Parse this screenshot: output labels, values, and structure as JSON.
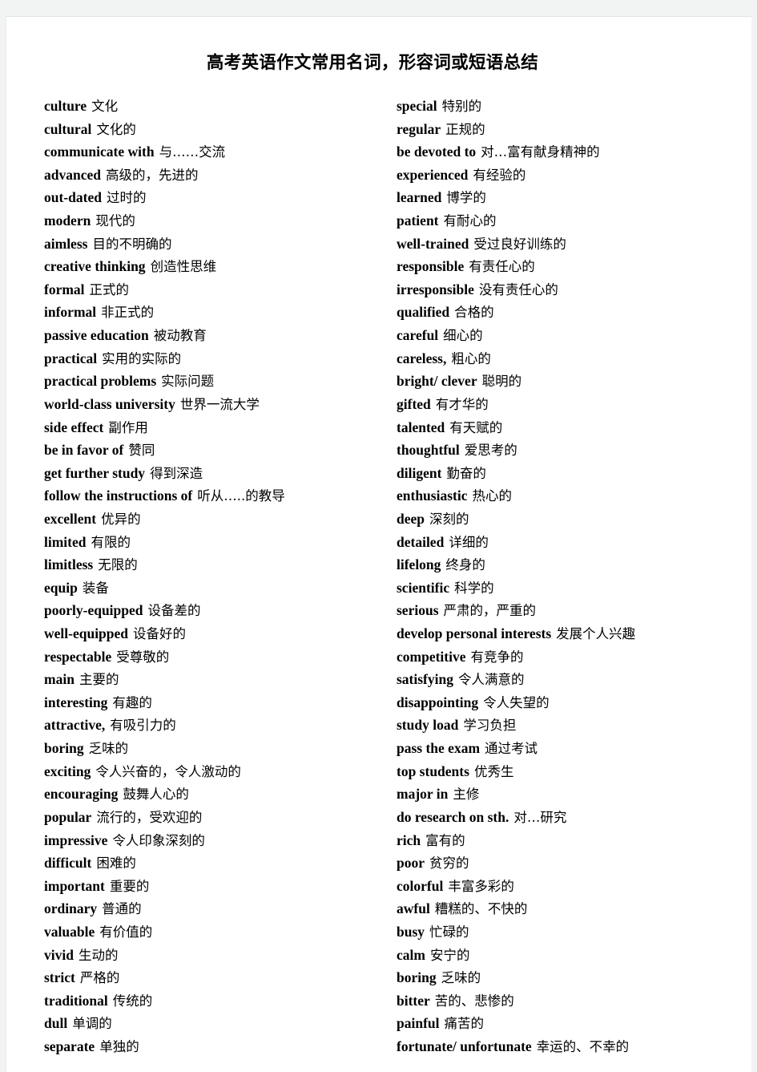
{
  "document": {
    "title": "高考英语作文常用名词，形容词或短语总结",
    "page_background": "#ffffff",
    "surround_background": "#f2f3f3",
    "text_color": "#000000"
  },
  "columns": {
    "left": [
      {
        "term": "culture",
        "gloss": "文化"
      },
      {
        "term": "cultural",
        "gloss": "文化的"
      },
      {
        "term": "communicate with",
        "gloss": "与……交流"
      },
      {
        "term": "advanced",
        "gloss": "高级的，先进的"
      },
      {
        "term": "out-dated",
        "gloss": "过时的"
      },
      {
        "term": "modern",
        "gloss": "现代的"
      },
      {
        "term": "aimless",
        "gloss": "目的不明确的"
      },
      {
        "term": "creative thinking",
        "gloss": "创造性思维"
      },
      {
        "term": "formal",
        "gloss": "正式的"
      },
      {
        "term": "informal",
        "gloss": "非正式的"
      },
      {
        "term": "passive education",
        "gloss": "被动教育"
      },
      {
        "term": "practical",
        "gloss": "实用的实际的"
      },
      {
        "term": "practical problems",
        "gloss": "实际问题"
      },
      {
        "term": "world-class university",
        "gloss": "世界一流大学"
      },
      {
        "term": "side effect",
        "gloss": "副作用"
      },
      {
        "term": "be in favor of",
        "gloss": "赞同"
      },
      {
        "term": "get further study",
        "gloss": "得到深造"
      },
      {
        "term": "follow the instructions of",
        "gloss": "听从…..的教导"
      },
      {
        "term": "excellent",
        "gloss": "优异的"
      },
      {
        "term": "limited",
        "gloss": "有限的"
      },
      {
        "term": "limitless",
        "gloss": "无限的"
      },
      {
        "term": "equip",
        "gloss": "装备"
      },
      {
        "term": "poorly-equipped",
        "gloss": "设备差的"
      },
      {
        "term": "well-equipped",
        "gloss": "设备好的"
      },
      {
        "term": "respectable",
        "gloss": "受尊敬的"
      },
      {
        "term": "main",
        "gloss": "主要的"
      },
      {
        "term": "interesting",
        "gloss": "有趣的"
      },
      {
        "term": "attractive,",
        "gloss": "有吸引力的"
      },
      {
        "term": "boring",
        "gloss": "乏味的"
      },
      {
        "term": "exciting",
        "gloss": "令人兴奋的，令人激动的"
      },
      {
        "term": "encouraging",
        "gloss": "鼓舞人心的"
      },
      {
        "term": "popular",
        "gloss": "流行的，受欢迎的"
      },
      {
        "term": "impressive",
        "gloss": "令人印象深刻的"
      },
      {
        "term": "difficult",
        "gloss": "困难的"
      },
      {
        "term": "important",
        "gloss": "重要的"
      },
      {
        "term": "ordinary",
        "gloss": "普通的"
      },
      {
        "term": "valuable",
        "gloss": "有价值的"
      },
      {
        "term": "vivid",
        "gloss": "生动的"
      },
      {
        "term": "strict",
        "gloss": "严格的"
      },
      {
        "term": "traditional",
        "gloss": "传统的"
      },
      {
        "term": "dull",
        "gloss": "单调的"
      },
      {
        "term": "separate",
        "gloss": "单独的"
      }
    ],
    "right": [
      {
        "term": "special",
        "gloss": "特别的"
      },
      {
        "term": "regular",
        "gloss": "正规的"
      },
      {
        "term": "be devoted to",
        "gloss": "对…富有献身精神的"
      },
      {
        "term": "experienced",
        "gloss": "有经验的"
      },
      {
        "term": "learned",
        "gloss": "博学的"
      },
      {
        "term": "patient",
        "gloss": "有耐心的"
      },
      {
        "term": "well-trained",
        "gloss": "受过良好训练的"
      },
      {
        "term": "responsible",
        "gloss": "有责任心的"
      },
      {
        "term": "irresponsible",
        "gloss": "没有责任心的"
      },
      {
        "term": "qualified",
        "gloss": "合格的"
      },
      {
        "term": "careful",
        "gloss": "细心的"
      },
      {
        "term": "careless,",
        "gloss": "粗心的"
      },
      {
        "term": "bright/ clever",
        "gloss": "聪明的"
      },
      {
        "term": "gifted",
        "gloss": "有才华的"
      },
      {
        "term": "talented",
        "gloss": "有天赋的"
      },
      {
        "term": "thoughtful",
        "gloss": "爱思考的"
      },
      {
        "term": "diligent",
        "gloss": "勤奋的"
      },
      {
        "term": "enthusiastic",
        "gloss": "热心的"
      },
      {
        "term": "deep",
        "gloss": "深刻的"
      },
      {
        "term": "detailed",
        "gloss": "详细的"
      },
      {
        "term": "lifelong",
        "gloss": "终身的"
      },
      {
        "term": "scientific",
        "gloss": "科学的"
      },
      {
        "term": "serious",
        "gloss": "严肃的，严重的"
      },
      {
        "term": "develop personal interests",
        "gloss": "发展个人兴趣"
      },
      {
        "term": "competitive",
        "gloss": "有竞争的"
      },
      {
        "term": "satisfying",
        "gloss": "令人满意的"
      },
      {
        "term": "disappointing",
        "gloss": "令人失望的"
      },
      {
        "term": "study load",
        "gloss": "学习负担"
      },
      {
        "term": "pass the exam",
        "gloss": "通过考试"
      },
      {
        "term": "top students",
        "gloss": "优秀生"
      },
      {
        "term": "major in",
        "gloss": "主修"
      },
      {
        "term": "do research on sth.",
        "gloss": "对…研究"
      },
      {
        "term": "rich",
        "gloss": "富有的"
      },
      {
        "term": "poor",
        "gloss": "贫穷的"
      },
      {
        "term": "colorful",
        "gloss": "丰富多彩的"
      },
      {
        "term": "awful",
        "gloss": "糟糕的、不快的"
      },
      {
        "term": "busy",
        "gloss": "忙碌的"
      },
      {
        "term": "calm",
        "gloss": "安宁的"
      },
      {
        "term": "boring",
        "gloss": "乏味的"
      },
      {
        "term": "bitter",
        "gloss": "苦的、悲惨的"
      },
      {
        "term": "painful",
        "gloss": "痛苦的"
      },
      {
        "term": "fortunate/ unfortunate",
        "gloss": "幸运的、不幸的"
      }
    ]
  }
}
